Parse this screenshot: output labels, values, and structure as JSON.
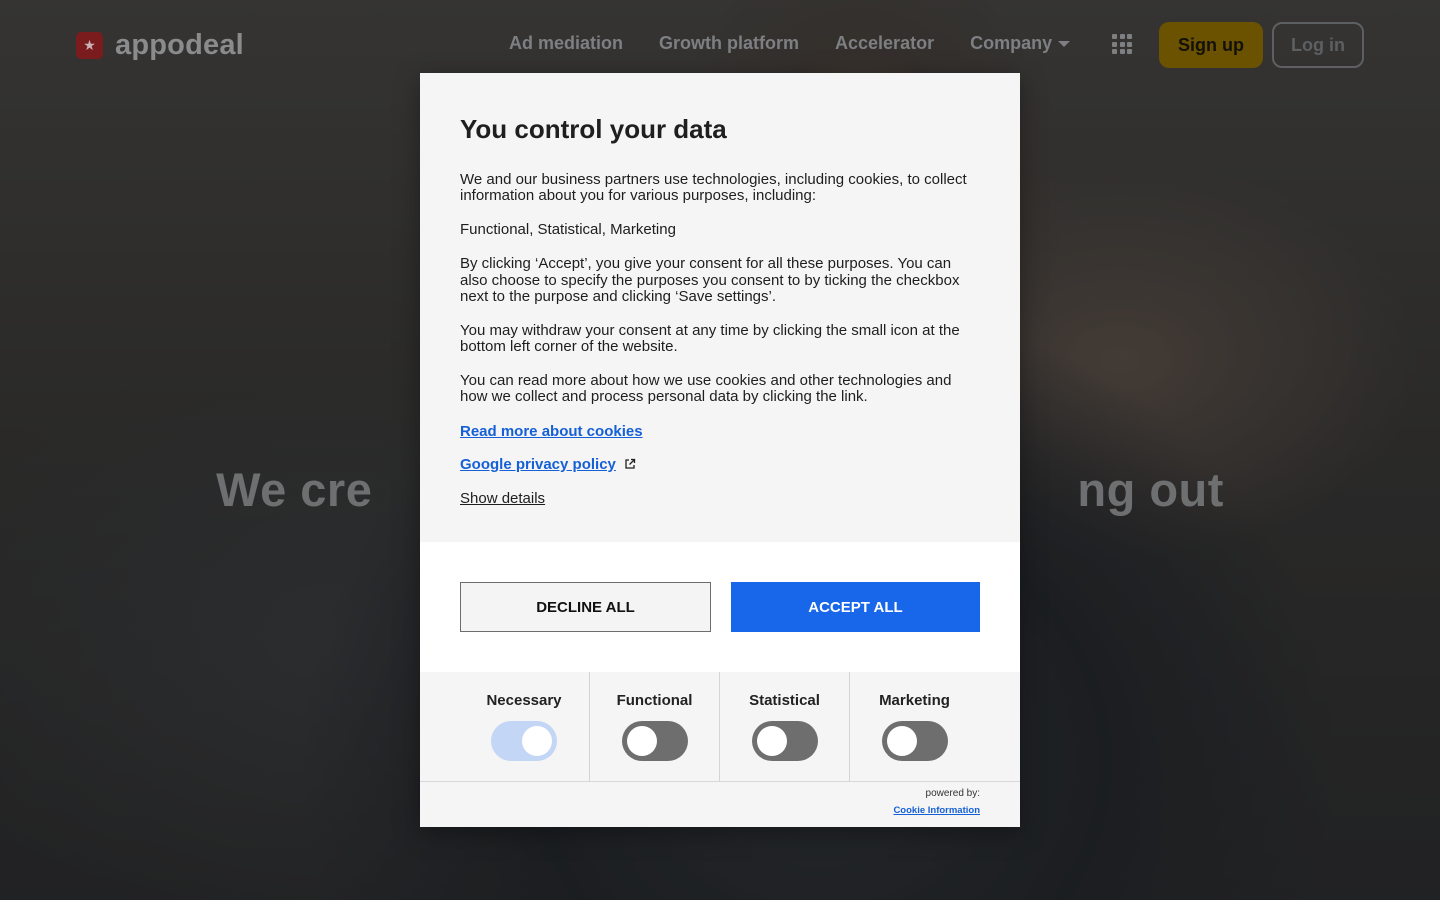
{
  "header": {
    "logo_text": "appodeal",
    "nav": [
      {
        "label": "Ad mediation"
      },
      {
        "label": "Growth platform"
      },
      {
        "label": "Accelerator"
      },
      {
        "label": "Company"
      }
    ],
    "signup_label": "Sign up",
    "login_label": "Log in"
  },
  "hero": {
    "headline": "We cre                                                    ng out"
  },
  "consent": {
    "title": "You control your data",
    "paragraphs": [
      "We and our business partners use technologies, including cookies, to collect information about you for various purposes, including:",
      "Functional, Statistical, Marketing",
      "By clicking ‘Accept’, you give your consent for all these purposes. You can also choose to specify the purposes you consent to by ticking the checkbox next to the purpose and clicking ‘Save settings’.",
      "You may withdraw your consent at any time by clicking the small icon at the bottom left corner of the website.",
      "You can read more about how we use cookies and other technologies and how we collect and process personal data by clicking the link."
    ],
    "read_more_link": "Read more about cookies",
    "google_policy_link": "Google privacy policy",
    "show_details_label": "Show details",
    "decline_label": "DECLINE ALL",
    "accept_label": "ACCEPT ALL",
    "categories": [
      {
        "label": "Necessary",
        "enabled": true
      },
      {
        "label": "Functional",
        "enabled": false
      },
      {
        "label": "Statistical",
        "enabled": false
      },
      {
        "label": "Marketing",
        "enabled": false
      }
    ],
    "powered_by": "powered by:",
    "powered_by_link": "Cookie Information"
  },
  "colors": {
    "accept_button": "#1866ea",
    "link": "#1560d6",
    "signup_button": "#6a5200",
    "toggle_on": "#c4d6f5",
    "toggle_off": "#6e6e6e"
  }
}
